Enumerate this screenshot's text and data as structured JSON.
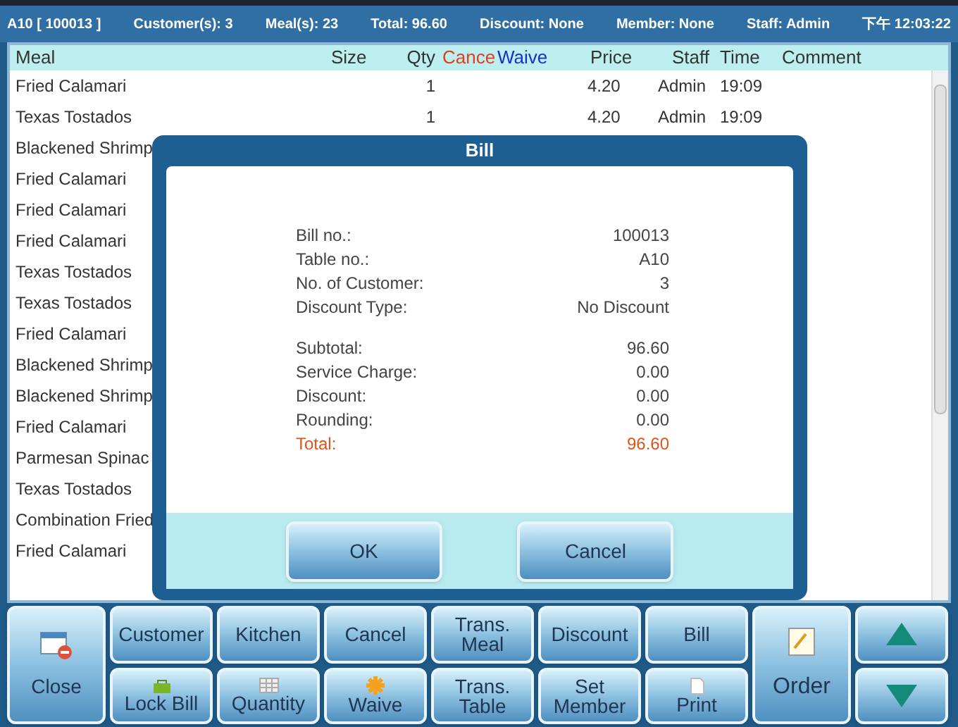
{
  "status_bar": [
    "A10 [ 100013 ]",
    "Customer(s): 3",
    "Meal(s): 23",
    "Total: 96.60",
    "Discount: None",
    "Member: None",
    "Staff: Admin",
    "下午 12:03:22"
  ],
  "table": {
    "columns": [
      {
        "label": "Meal",
        "color": "#333333"
      },
      {
        "label": "Size",
        "color": "#333333"
      },
      {
        "label": "Qty",
        "color": "#333333"
      },
      {
        "label": "Cance",
        "color": "#e0401a"
      },
      {
        "label": "Waive",
        "color": "#1a2fc8"
      },
      {
        "label": "Price",
        "color": "#333333"
      },
      {
        "label": "Staff",
        "color": "#333333"
      },
      {
        "label": "Time",
        "color": "#333333"
      },
      {
        "label": "Comment",
        "color": "#333333"
      }
    ],
    "rows": [
      {
        "meal": "Fried Calamari",
        "qty": "1",
        "price": "4.20",
        "staff": "Admin",
        "time": "19:09"
      },
      {
        "meal": "Texas Tostados",
        "qty": "1",
        "price": "4.20",
        "staff": "Admin",
        "time": "19:09"
      },
      {
        "meal": "Blackened Shrimp"
      },
      {
        "meal": "Fried Calamari"
      },
      {
        "meal": "Fried Calamari"
      },
      {
        "meal": "Fried Calamari"
      },
      {
        "meal": "Texas Tostados"
      },
      {
        "meal": "Texas Tostados"
      },
      {
        "meal": "Fried Calamari"
      },
      {
        "meal": "Blackened Shrimp"
      },
      {
        "meal": "Blackened Shrimp"
      },
      {
        "meal": "Fried Calamari"
      },
      {
        "meal": "Parmesan Spinac"
      },
      {
        "meal": "Texas Tostados"
      },
      {
        "meal": "Combination Fried"
      },
      {
        "meal": "Fried Calamari"
      }
    ]
  },
  "dialog": {
    "title": "Bill",
    "groups": [
      [
        {
          "label": "Bill no.:",
          "value": "100013",
          "kind": "normal"
        },
        {
          "label": "Table no.:",
          "value": "A10",
          "kind": "normal"
        },
        {
          "label": "No. of Customer:",
          "value": "3",
          "kind": "normal"
        },
        {
          "label": "Discount Type:",
          "value": "No Discount",
          "kind": "normal"
        }
      ],
      [
        {
          "label": "Subtotal:",
          "value": "96.60",
          "kind": "normal"
        },
        {
          "label": "Service Charge:",
          "value": "0.00",
          "kind": "normal"
        },
        {
          "label": "Discount:",
          "value": "0.00",
          "kind": "normal"
        },
        {
          "label": "Rounding:",
          "value": "0.00",
          "kind": "normal"
        },
        {
          "label": "Total:",
          "value": "96.60",
          "kind": "total"
        }
      ]
    ],
    "buttons": [
      "OK",
      "Cancel"
    ]
  },
  "toolbar": {
    "close": "Close",
    "top_row": [
      "Customer",
      "Kitchen",
      "Cancel",
      "Trans. Meal",
      "Discount",
      "Bill"
    ],
    "bottom_row": [
      "Lock Bill",
      "Quantity",
      "Waive",
      "Trans. Table",
      "Set Member",
      "Print"
    ],
    "order": "Order"
  }
}
